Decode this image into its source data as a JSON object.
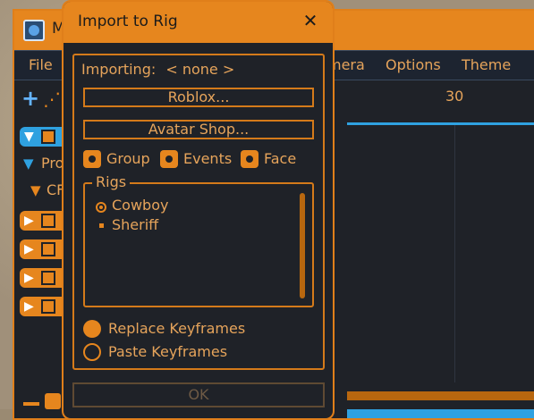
{
  "app": {
    "title_partial": "M",
    "menu": [
      "File",
      "mera",
      "Options",
      "Theme"
    ],
    "timeline": {
      "label_30": "30"
    },
    "tree": {
      "items": [
        "Pro",
        "CF"
      ]
    }
  },
  "dialog": {
    "title": "Import to Rig",
    "importing_label": "Importing:",
    "importing_value": "< none >",
    "btn_roblox": "Roblox...",
    "btn_avatar_shop": "Avatar Shop...",
    "toggles": [
      {
        "label": "Group",
        "checked": true
      },
      {
        "label": "Events",
        "checked": true
      },
      {
        "label": "Face",
        "checked": true
      }
    ],
    "rigs": {
      "legend": "Rigs",
      "items": [
        {
          "label": "Cowboy",
          "selected": true
        },
        {
          "label": "Sheriff",
          "selected": false
        }
      ]
    },
    "options": [
      {
        "label": "Replace Keyframes",
        "selected": true
      },
      {
        "label": "Paste Keyframes",
        "selected": false
      }
    ],
    "ok_label": "OK"
  },
  "colors": {
    "accent_orange": "#e6861e",
    "accent_blue": "#2fa1e0",
    "panel_dark": "#1f2228",
    "text_orange": "#e6a45b"
  },
  "icons": {
    "close": "close-icon",
    "app": "app-icon",
    "plus": "plus-icon",
    "rig": "rig-icon"
  }
}
